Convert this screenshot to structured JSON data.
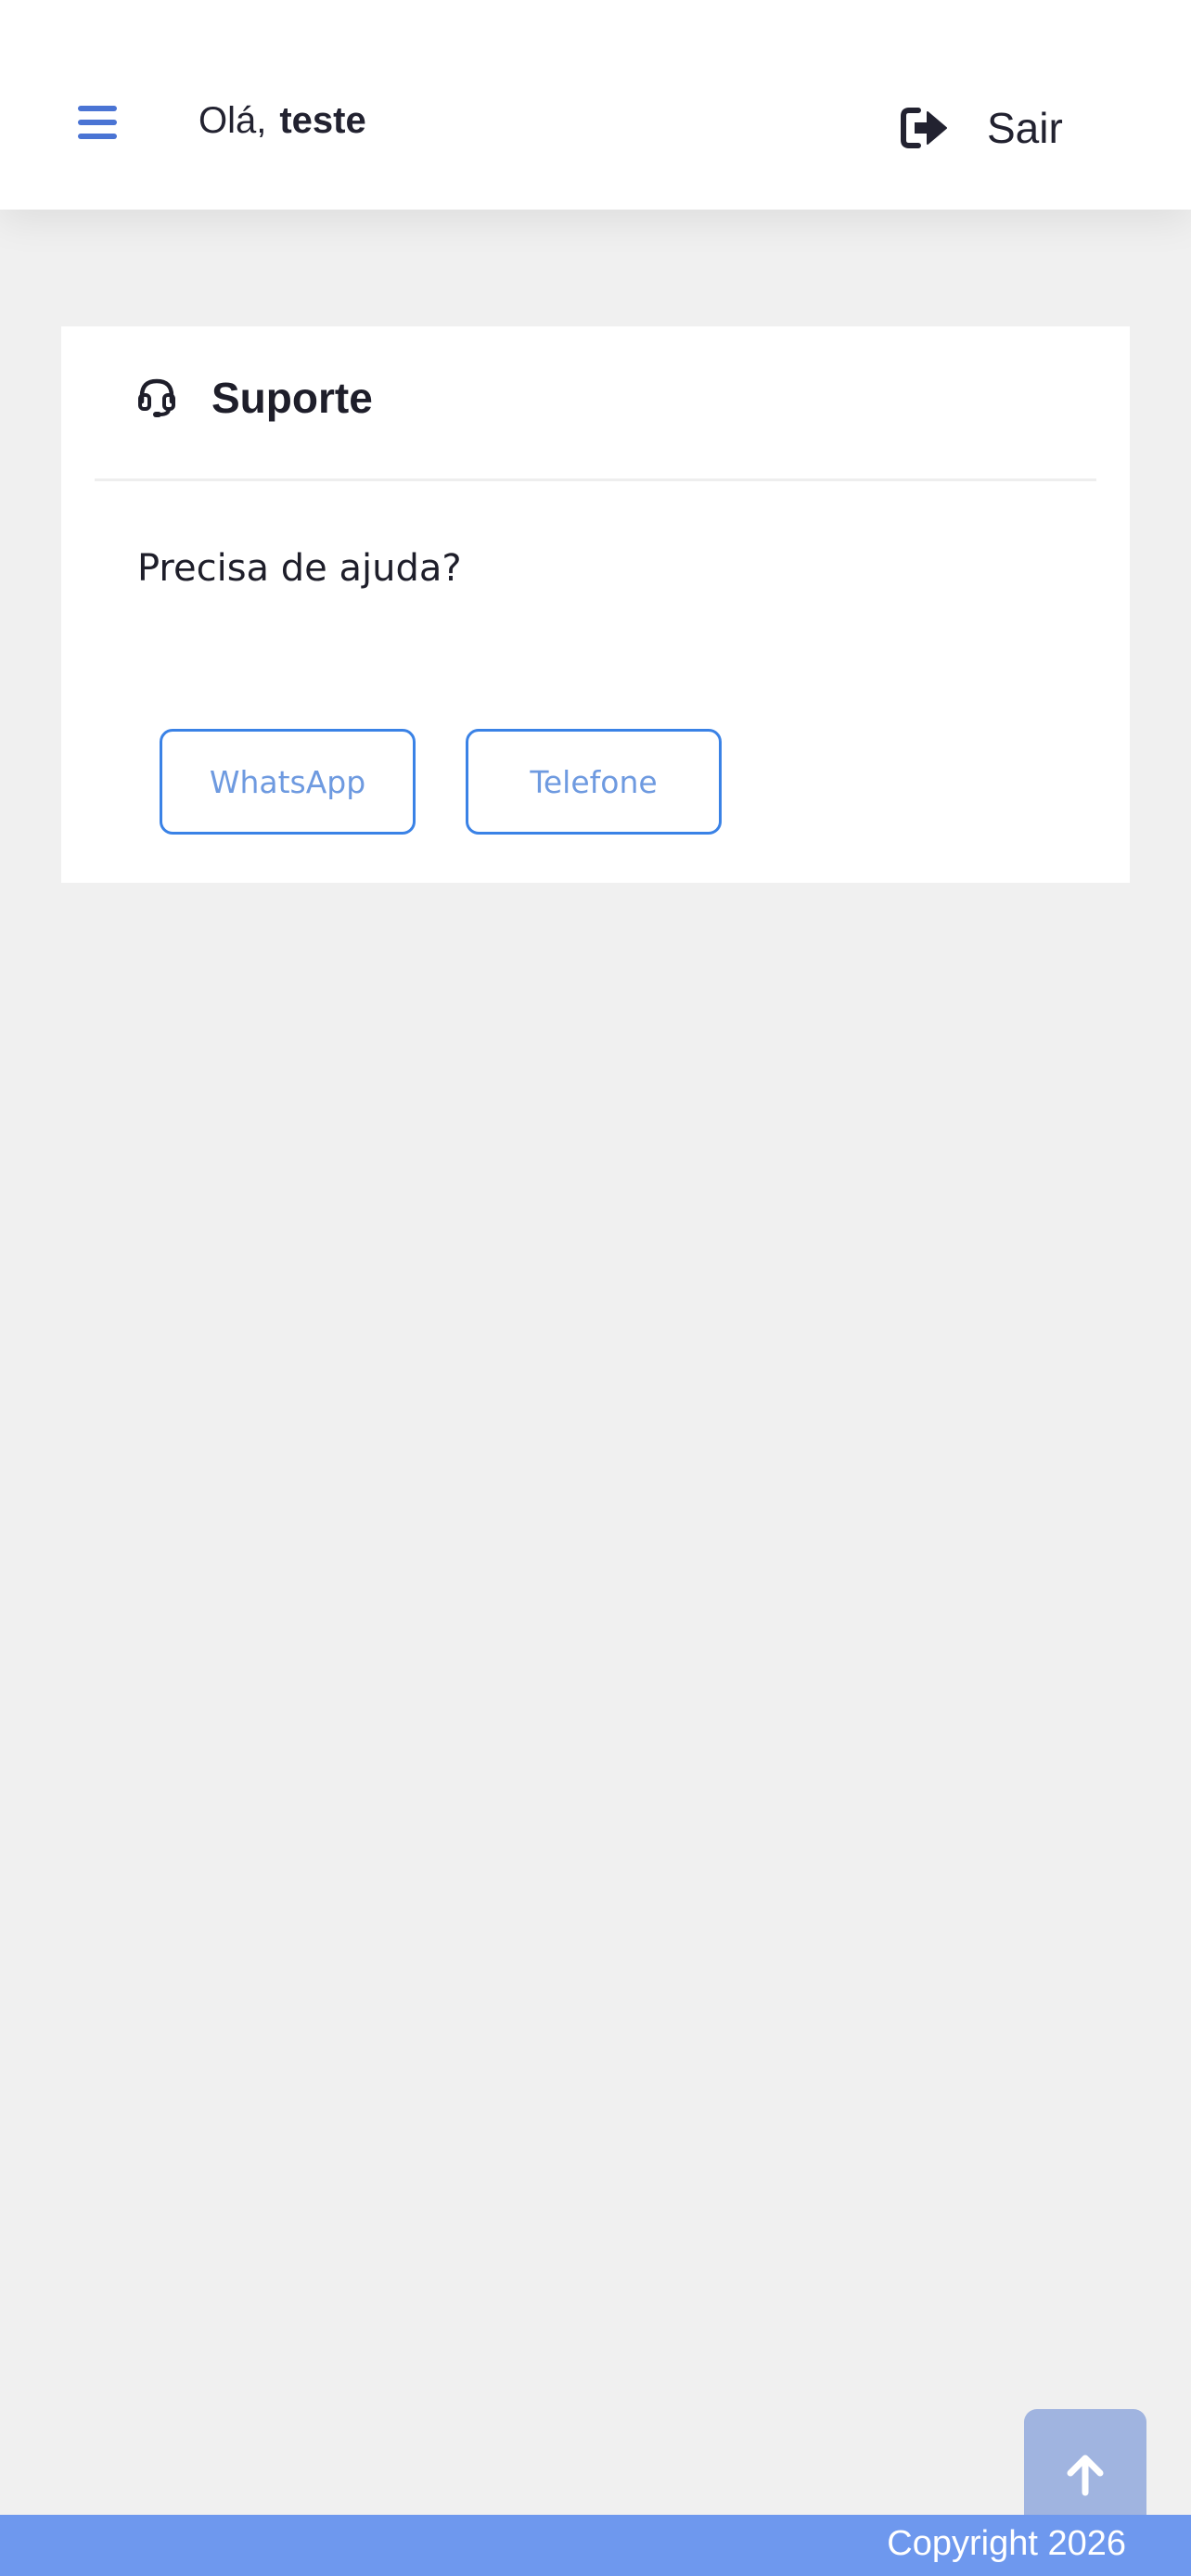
{
  "header": {
    "greeting": "Olá,",
    "user_name": "teste",
    "logout_label": "Sair",
    "menu_icon": "hamburger-icon",
    "logout_icon": "sign-out-icon"
  },
  "support_card": {
    "icon": "headset-icon",
    "title": "Suporte",
    "help_text": "Precisa de ajuda?",
    "buttons": [
      {
        "label": "WhatsApp"
      },
      {
        "label": "Telefone"
      }
    ]
  },
  "scroll_top": {
    "icon": "arrow-up-icon"
  },
  "footer": {
    "copyright": "Copyright 2026"
  },
  "colors": {
    "accent": "#4a74d4",
    "button_border": "#3a82e6",
    "button_text": "#6e9ae0",
    "footer_bg": "#6e98ee",
    "scroll_top_bg": "#a0b4e0",
    "page_bg": "#f0f0f0"
  }
}
